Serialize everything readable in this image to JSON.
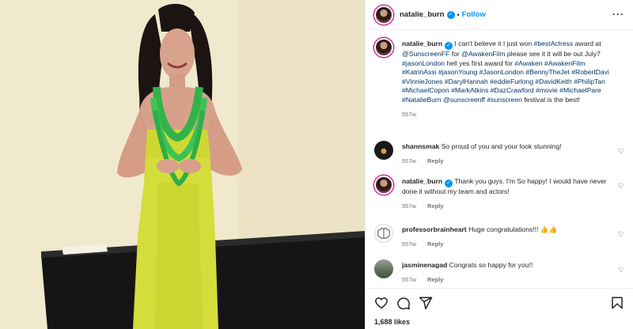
{
  "post": {
    "username": "natalie_burn",
    "follow_label": "Follow",
    "separator": "•",
    "more_label": "···"
  },
  "caption": {
    "username": "natalie_burn",
    "text_1": " I can't believe it I just won ",
    "tag_bestactress": "#bestActress",
    "text_2": " award at ",
    "mention_sunscreenff": "@SunscreenFF",
    "text_3": " for ",
    "mention_awakenfilm": "@AwakenFilm",
    "text_4": " please see it it will be out July7 ",
    "mention_jasonlondon": "#jasonLondon",
    "text_5": " hell yes first award for ",
    "hashtags_line": "#Awaken #AwakenFilm #KatrinAssi #jasonYoung #JasonLondon #BennyTheJet #RobertDavi #VinnieJones #DarylHannah #eddieFurlong #DavidKeith #PhilipTan #MichaelCopon #MarkAtkins #DazCrawford #movie #MichaelPare #NatalieBurn @sunscreenff #sunscreen",
    "text_6": " festival is the best!",
    "age": "557w"
  },
  "comments": [
    {
      "username": "shannsmak",
      "text": "So proud of you and your look stunning!",
      "age": "557w",
      "reply_label": "Reply"
    },
    {
      "username": "natalie_burn",
      "text": "Thank you guys. I'm So happy! I would have never done it without my team and actors!",
      "age": "557w",
      "reply_label": "Reply"
    },
    {
      "username": "professorbrainheart",
      "text": "Huge congratulations!!! 👍👍",
      "age": "557w",
      "reply_label": "Reply"
    },
    {
      "username": "jasminenagad",
      "text": "Congrats so happy for you!!",
      "age": "557w",
      "reply_label": "Reply"
    }
  ],
  "actions": {
    "likes": "1,688 likes",
    "like_icon": "heart-icon",
    "comment_icon": "comment-icon",
    "share_icon": "share-icon",
    "save_icon": "bookmark-icon"
  },
  "colors": {
    "link": "#00376b",
    "follow": "#0095f6",
    "verified": "#0095f6"
  }
}
